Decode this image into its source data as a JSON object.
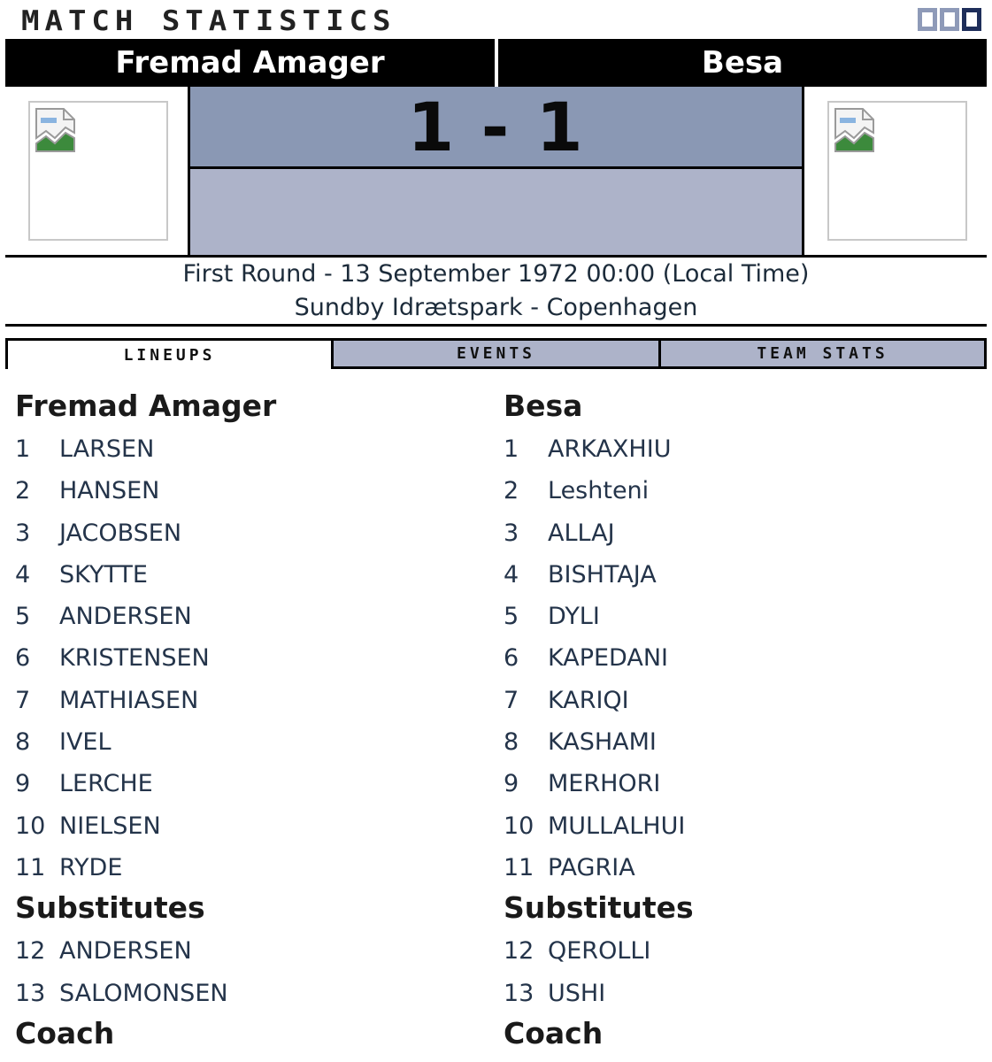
{
  "title": "MATCH STATISTICS",
  "teams": {
    "home": "Fremad Amager",
    "away": "Besa"
  },
  "score": "1 - 1",
  "match_info": {
    "line1": "First Round - 13 September 1972 00:00 (Local Time)",
    "line2": "Sundby Idrætspark - Copenhagen"
  },
  "tabs": [
    "LINEUPS",
    "EVENTS",
    "TEAM STATS"
  ],
  "active_tab": "LINEUPS",
  "home": {
    "team": "Fremad Amager",
    "players": [
      {
        "num": "1",
        "name": "LARSEN"
      },
      {
        "num": "2",
        "name": "HANSEN"
      },
      {
        "num": "3",
        "name": "JACOBSEN"
      },
      {
        "num": "4",
        "name": "SKYTTE"
      },
      {
        "num": "5",
        "name": "ANDERSEN"
      },
      {
        "num": "6",
        "name": "KRISTENSEN"
      },
      {
        "num": "7",
        "name": "MATHIASEN"
      },
      {
        "num": "8",
        "name": "IVEL"
      },
      {
        "num": "9",
        "name": "LERCHE"
      },
      {
        "num": "10",
        "name": "NIELSEN"
      },
      {
        "num": "11",
        "name": "RYDE"
      }
    ],
    "substitutes_label": "Substitutes",
    "substitutes": [
      {
        "num": "12",
        "name": "ANDERSEN"
      },
      {
        "num": "13",
        "name": "SALOMONSEN"
      }
    ],
    "coach_label": "Coach"
  },
  "away": {
    "team": "Besa",
    "players": [
      {
        "num": "1",
        "name": "ARKAXHIU"
      },
      {
        "num": "2",
        "name": "Leshteni"
      },
      {
        "num": "3",
        "name": "ALLAJ"
      },
      {
        "num": "4",
        "name": "BISHTAJA"
      },
      {
        "num": "5",
        "name": "DYLI"
      },
      {
        "num": "6",
        "name": "KAPEDANI"
      },
      {
        "num": "7",
        "name": "KARIQI"
      },
      {
        "num": "8",
        "name": "KASHAMI"
      },
      {
        "num": "9",
        "name": "MERHORI"
      },
      {
        "num": "10",
        "name": "MULLALHUI"
      },
      {
        "num": "11",
        "name": "PAGRIA"
      }
    ],
    "substitutes_label": "Substitutes",
    "substitutes": [
      {
        "num": "12",
        "name": "QEROLLI"
      },
      {
        "num": "13",
        "name": "USHI"
      }
    ],
    "coach_label": "Coach"
  },
  "colors": {
    "header_bg": "#000000",
    "score_bg": "#8a98b4",
    "panel_bg": "#adb3c9",
    "tab_inactive": "#adb3c9",
    "text": "#1c2b3a"
  },
  "icons": [
    "minimize-icon",
    "maximize-icon",
    "close-icon",
    "broken-image-icon"
  ]
}
